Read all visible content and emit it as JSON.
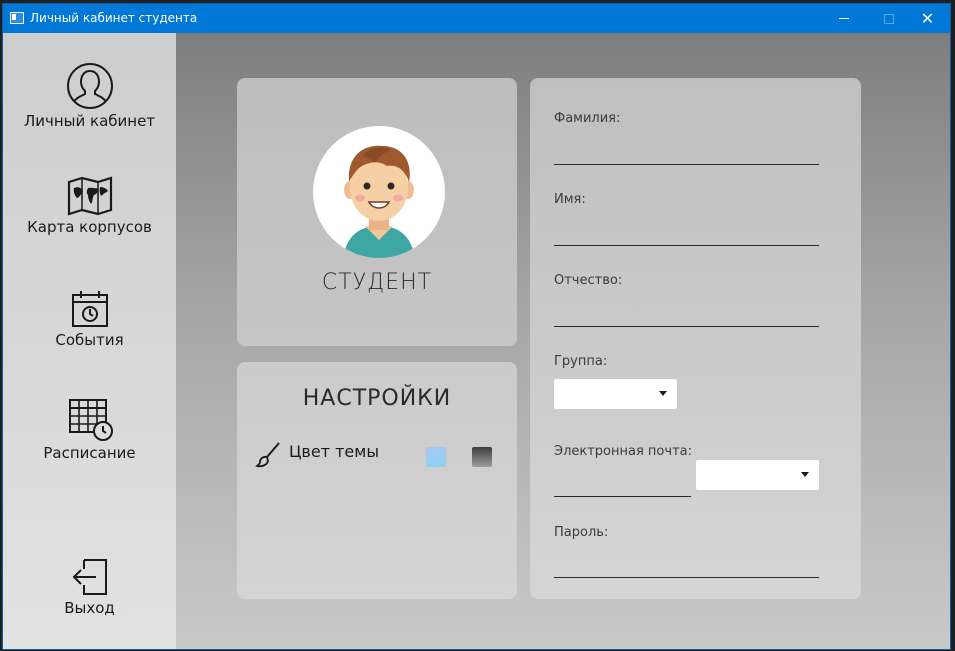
{
  "window": {
    "title": "Личный кабинет студента",
    "close_glyph": "✕"
  },
  "sidebar": {
    "items": [
      {
        "label": "Личный кабинет",
        "icon": "user-icon"
      },
      {
        "label": "Карта корпусов",
        "icon": "map-icon"
      },
      {
        "label": "События",
        "icon": "calendar-icon"
      },
      {
        "label": "Расписание",
        "icon": "schedule-icon"
      },
      {
        "label": "Выход",
        "icon": "exit-icon"
      }
    ]
  },
  "profile": {
    "role_label": "СТУДЕНТ",
    "avatar": "student-avatar"
  },
  "settings": {
    "title": "НАСТРОЙКИ",
    "theme_label": "Цвет темы",
    "theme_colors": [
      "#a7c8f5",
      "#3e3e3e"
    ]
  },
  "form": {
    "last_name": {
      "label": "Фамилия:",
      "value": ""
    },
    "first_name": {
      "label": "Имя:",
      "value": ""
    },
    "patronymic": {
      "label": "Отчество:",
      "value": ""
    },
    "group": {
      "label": "Группа:",
      "value": ""
    },
    "email": {
      "label": "Электронная почта:",
      "value": "",
      "domain_value": ""
    },
    "password": {
      "label": "Пароль:",
      "value": ""
    }
  },
  "colors": {
    "titlebar": "#0078d7",
    "sidebar": "#d5d5d5"
  }
}
